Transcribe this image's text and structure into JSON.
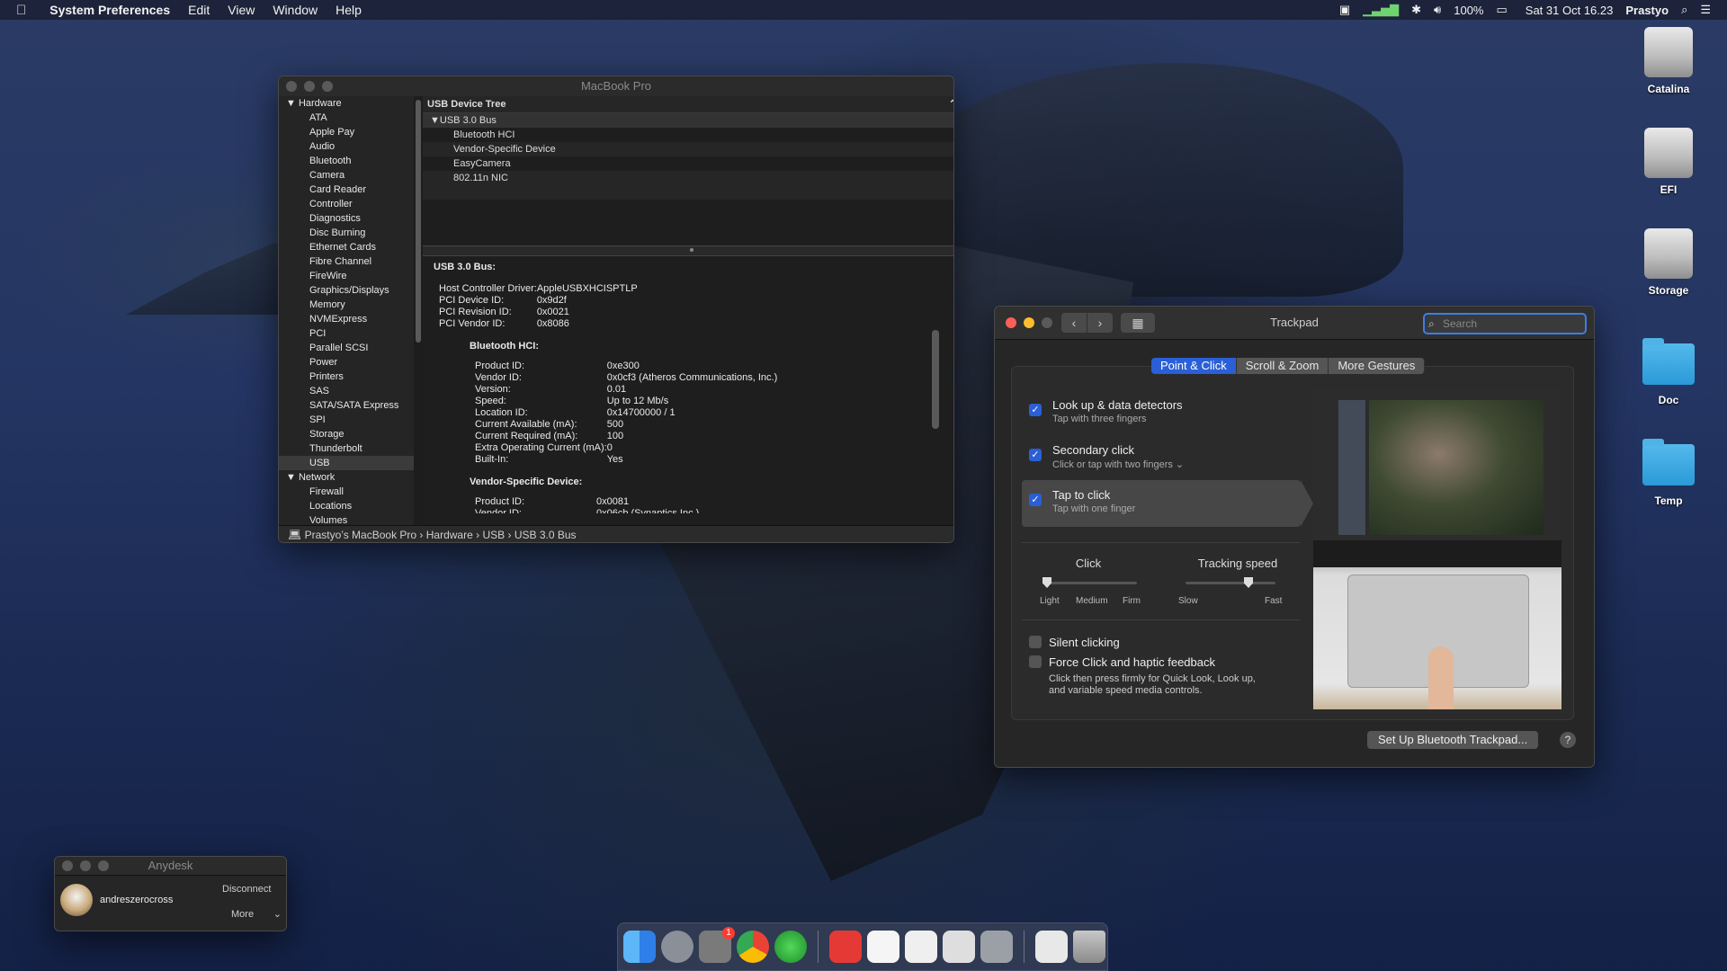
{
  "menubar": {
    "app": "System Preferences",
    "menus": [
      "Edit",
      "View",
      "Window",
      "Help"
    ],
    "battery": "100%",
    "clock": "Sat 31 Oct 16.23",
    "user": "Prastyo"
  },
  "desktop": {
    "icons": [
      "Catalina",
      "EFI",
      "Storage",
      "Doc",
      "Temp"
    ]
  },
  "sysinfo": {
    "title": "MacBook Pro",
    "sidebar": {
      "hardware": "Hardware",
      "hardware_items": [
        "ATA",
        "Apple Pay",
        "Audio",
        "Bluetooth",
        "Camera",
        "Card Reader",
        "Controller",
        "Diagnostics",
        "Disc Burning",
        "Ethernet Cards",
        "Fibre Channel",
        "FireWire",
        "Graphics/Displays",
        "Memory",
        "NVMExpress",
        "PCI",
        "Parallel SCSI",
        "Power",
        "Printers",
        "SAS",
        "SATA/SATA Express",
        "SPI",
        "Storage",
        "Thunderbolt",
        "USB"
      ],
      "network": "Network",
      "network_items": [
        "Firewall",
        "Locations",
        "Volumes"
      ]
    },
    "tree": {
      "header": "USB Device Tree",
      "bus": "USB 3.0 Bus",
      "devices": [
        "Bluetooth HCI",
        "Vendor-Specific Device",
        "EasyCamera",
        "802.11n NIC"
      ]
    },
    "details": {
      "bus_title": "USB 3.0 Bus:",
      "bus_fields": [
        [
          "Host Controller Driver:",
          "AppleUSBXHCISPTLP"
        ],
        [
          "PCI Device ID:",
          "0x9d2f"
        ],
        [
          "PCI Revision ID:",
          "0x0021"
        ],
        [
          "PCI Vendor ID:",
          "0x8086"
        ]
      ],
      "bt_title": "Bluetooth HCI:",
      "bt_fields": [
        [
          "Product ID:",
          "0xe300"
        ],
        [
          "Vendor ID:",
          "0x0cf3  (Atheros Communications, Inc.)"
        ],
        [
          "Version:",
          "0.01"
        ],
        [
          "Speed:",
          "Up to 12 Mb/s"
        ],
        [
          "Location ID:",
          "0x14700000 / 1"
        ],
        [
          "Current Available (mA):",
          "500"
        ],
        [
          "Current Required (mA):",
          "100"
        ],
        [
          "Extra Operating Current (mA):",
          "0"
        ],
        [
          "Built-In:",
          "Yes"
        ]
      ],
      "vs_title": "Vendor-Specific Device:",
      "vs_fields": [
        [
          "Product ID:",
          "0x0081"
        ],
        [
          "Vendor ID:",
          "0x06cb  (Synaptics Inc.)"
        ]
      ]
    },
    "path": [
      "Prastyo’s MacBook Pro",
      "Hardware",
      "USB",
      "USB 3.0 Bus"
    ]
  },
  "trackpad": {
    "title": "Trackpad",
    "search_placeholder": "Search",
    "tabs": [
      "Point & Click",
      "Scroll & Zoom",
      "More Gestures"
    ],
    "options": [
      {
        "title": "Look up & data detectors",
        "sub": "Tap with three fingers",
        "checked": true
      },
      {
        "title": "Secondary click",
        "sub": "Click or tap with two fingers ⌄",
        "checked": true
      },
      {
        "title": "Tap to click",
        "sub": "Tap with one finger",
        "checked": true
      }
    ],
    "click_label": "Click",
    "click_ticks": [
      "Light",
      "Medium",
      "Firm"
    ],
    "click_level": 0,
    "speed_label": "Tracking speed",
    "speed_ticks": [
      "Slow",
      "Fast"
    ],
    "speed_level": 0.7,
    "silent": "Silent clicking",
    "force": "Force Click and haptic feedback",
    "force_desc1": "Click then press firmly for Quick Look, Look up,",
    "force_desc2": "and variable speed media controls.",
    "bt_button": "Set Up Bluetooth Trackpad...",
    "help": "?"
  },
  "anydesk": {
    "title": "Anydesk",
    "user": "andreszerocross",
    "disconnect": "Disconnect",
    "more": "More"
  },
  "dock": {
    "badge": "1"
  }
}
